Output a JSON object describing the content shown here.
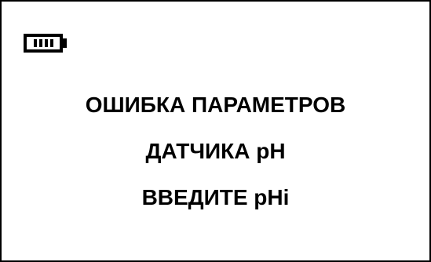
{
  "status": {
    "battery_icon": "battery-full-icon",
    "battery_level": 1.0,
    "battery_bars": 4
  },
  "message": {
    "line1": "ОШИБКА ПАРАМЕТРОВ",
    "line2": "ДАТЧИКА pH",
    "line3": "ВВЕДИТЕ pHi"
  },
  "colors": {
    "background": "#ffffff",
    "foreground": "#000000"
  }
}
